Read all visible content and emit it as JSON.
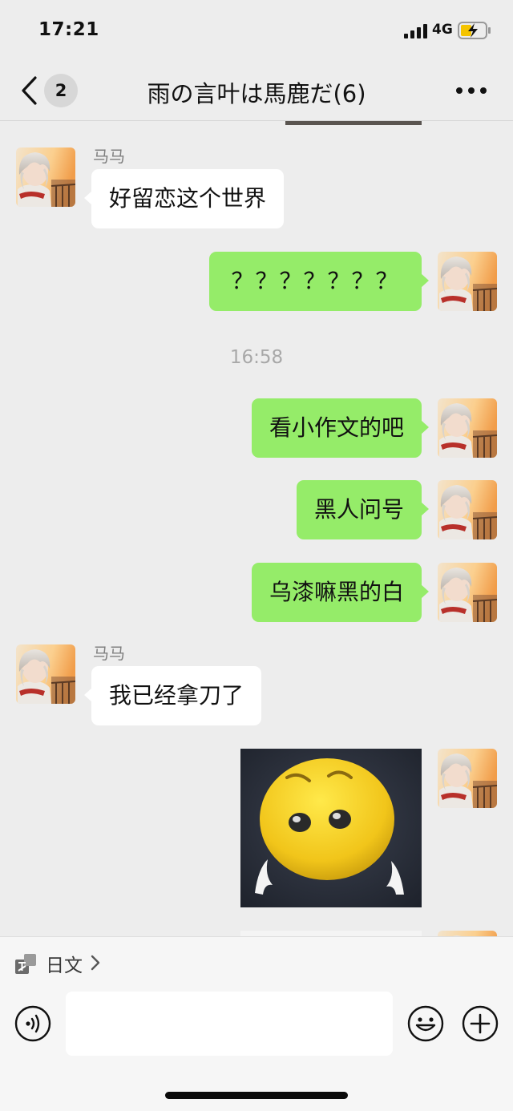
{
  "status_bar": {
    "time": "17:21",
    "network": "4G"
  },
  "nav": {
    "unread_count": "2",
    "title": "雨の言叶は馬鹿だ(6)"
  },
  "messages": [
    {
      "sender": "马马",
      "text": "好留恋这个世界"
    },
    {
      "text": "？？？？？？？"
    },
    {
      "time": "16:58"
    },
    {
      "text": "看小作文的吧"
    },
    {
      "text": "黑人问号"
    },
    {
      "text": "乌漆嘛黑的白"
    },
    {
      "sender": "马马",
      "text": "我已经拿刀了"
    }
  ],
  "translate": {
    "label": "日文"
  },
  "icons": {
    "back": "chevron-left-icon",
    "more": "ellipsis-icon",
    "translate": "translate-icon",
    "voice": "voice-icon",
    "emoji": "emoji-icon",
    "plus": "plus-icon"
  },
  "colors": {
    "outgoing_bubble": "#95ec69",
    "incoming_bubble": "#ffffff",
    "background": "#ededed"
  }
}
